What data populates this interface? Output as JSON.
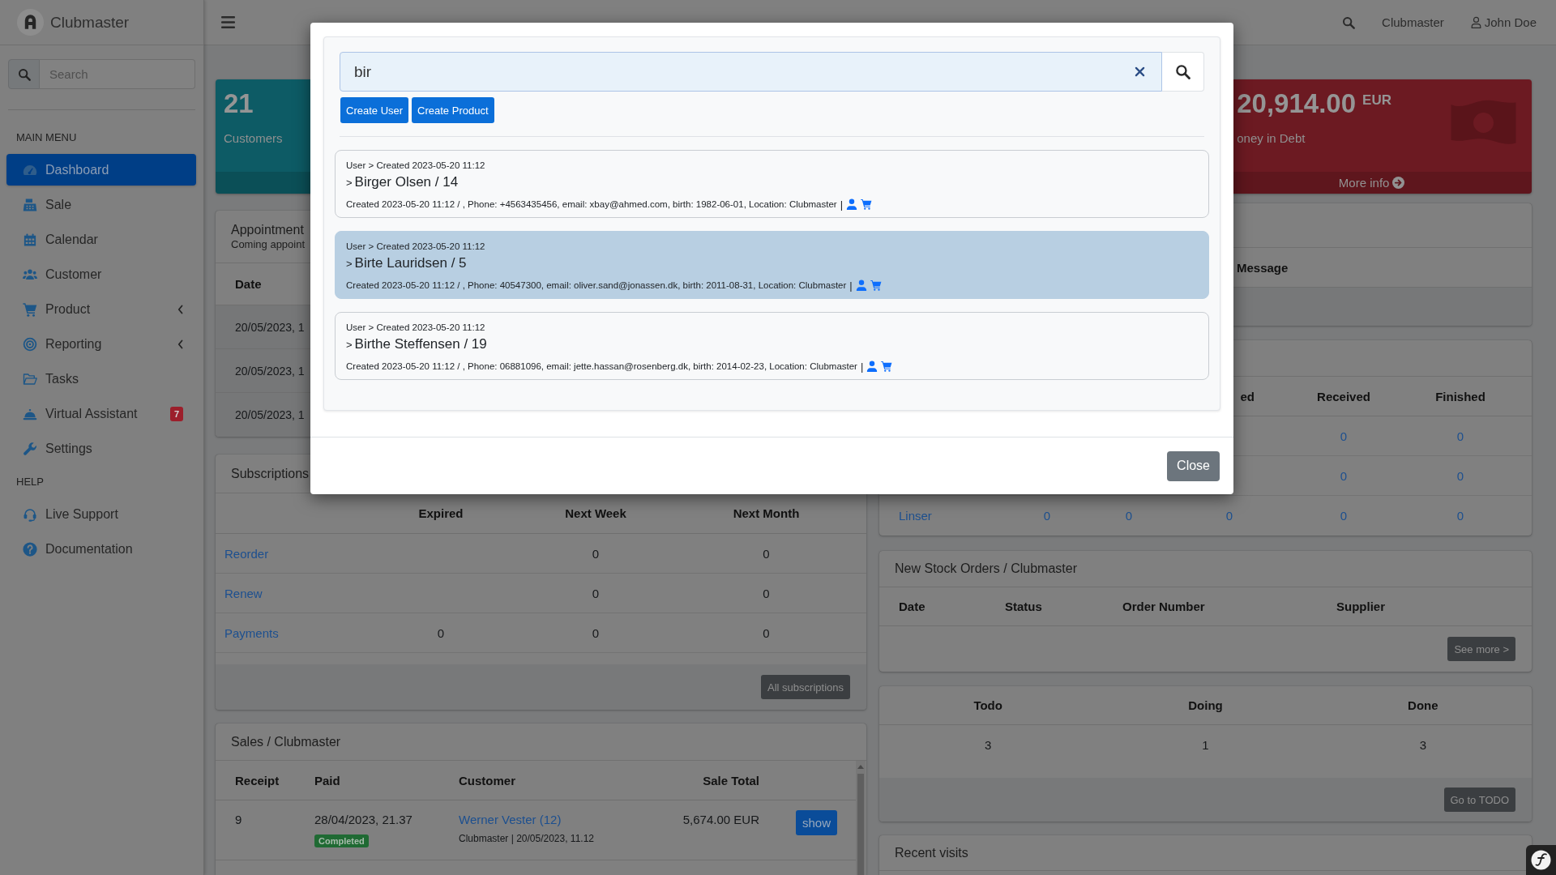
{
  "sidebar": {
    "brand": "Clubmaster",
    "search": {
      "placeholder": "Search"
    },
    "sections": [
      {
        "heading": "MAIN MENU",
        "items": [
          {
            "label": "Dashboard",
            "kind": "link",
            "selected": true
          },
          {
            "label": "Sale",
            "kind": "link",
            "selected": false
          },
          {
            "label": "Calendar",
            "kind": "link",
            "selected": false
          },
          {
            "label": "Customer",
            "kind": "link",
            "selected": false
          },
          {
            "label": "Product",
            "kind": "submenu",
            "selected": false
          },
          {
            "label": "Reporting",
            "kind": "submenu",
            "selected": false
          },
          {
            "label": "Tasks",
            "kind": "link",
            "selected": false
          },
          {
            "label": "Virtual Assistant",
            "kind": "link",
            "selected": false,
            "badge": "7"
          },
          {
            "label": "Settings",
            "kind": "link",
            "selected": false
          }
        ]
      },
      {
        "heading": "HELP",
        "items": [
          {
            "label": "Live Support",
            "kind": "link",
            "selected": false
          },
          {
            "label": "Documentation",
            "kind": "link",
            "selected": false
          }
        ]
      }
    ]
  },
  "topbar": {
    "site": "Clubmaster",
    "user": "John Doe"
  },
  "info_boxes": [
    {
      "value": "21",
      "label": "Customers",
      "color": "#0d5b65"
    },
    {
      "value": "20,914.00",
      "unit": "EUR",
      "label": "oney in Debt",
      "link": "More info",
      "color": "#6c1a22"
    }
  ],
  "appointments": {
    "title": "Appointment",
    "subtitle": "Coming appoint",
    "columns": [
      "Date"
    ],
    "rows": [
      {
        "date": "20/05/2023, 1"
      },
      {
        "date": "20/05/2023, 1"
      },
      {
        "date": "20/05/2023, 1"
      }
    ]
  },
  "subscriptions": {
    "title": "Subscriptions",
    "columns": [
      "Expired",
      "Next Week",
      "Next Month"
    ],
    "rows": [
      {
        "name": "Reorder",
        "next_week": "0",
        "next_month": "0"
      },
      {
        "name": "Renew",
        "next_week": "0",
        "next_month": "0"
      },
      {
        "name": "Payments",
        "expired": "0",
        "next_week": "0",
        "next_month": "0"
      }
    ],
    "button": "All subscriptions"
  },
  "sales": {
    "title": "Sales / Clubmaster",
    "columns": [
      "Receipt",
      "Paid",
      "Customer",
      "Sale Total"
    ],
    "rows": [
      {
        "receipt": "9",
        "paid": "28/04/2023, 21.37",
        "status": "Completed",
        "customer": "Werner Vester (12)",
        "customer_info": "Clubmaster | 20/05/2023, 11.12",
        "total": "5,674.00 EUR",
        "action": "show"
      }
    ]
  },
  "message_table": {
    "columns": [
      "Message"
    ]
  },
  "order_table": {
    "columns": {
      "column_3": "ed",
      "received": "Received",
      "finished": "Finished"
    },
    "rows": [
      {
        "received": "0",
        "finished": "0"
      },
      {
        "received": "0",
        "finished": "0"
      },
      {
        "name": "Linser",
        "column_1": "0",
        "column_2": "0",
        "column_3": "0",
        "received": "0",
        "finished": "0"
      }
    ]
  },
  "stock_orders": {
    "title": "New Stock Orders / Clubmaster",
    "columns": [
      "Date",
      "Status",
      "Order Number",
      "Supplier"
    ],
    "button": "See more >"
  },
  "tasks": {
    "columns": [
      "Todo",
      "Doing",
      "Done"
    ],
    "values": [
      "3",
      "1",
      "3"
    ],
    "button": "Go to TODO"
  },
  "recent_visits": {
    "title": "Recent visits"
  },
  "search_modal": {
    "search": {
      "value": "bir"
    },
    "buttons": [
      "Create User",
      "Create Product"
    ],
    "results": [
      {
        "meta": "User > Created 2023-05-20 11:12",
        "marker": ">",
        "name": "Birger Olsen / 14",
        "details": "Created 2023-05-20 11:12 / , Phone: +4563435456, email: xbay@ahmed.com, birth: 1982-06-01, Location: Clubmaster",
        "separator": "|",
        "selected": false
      },
      {
        "meta": "User > Created 2023-05-20 11:12",
        "marker": ">",
        "name": "Birte Lauridsen / 5",
        "details": "Created 2023-05-20 11:12 / , Phone: 40547300, email: oliver.sand@jonassen.dk, birth: 2011-08-31, Location: Clubmaster",
        "separator": "|",
        "selected": true
      },
      {
        "meta": "User > Created 2023-05-20 11:12",
        "marker": ">",
        "name": "Birthe Steffensen / 19",
        "details": "Created 2023-05-20 11:12 / , Phone: 06881096, email: jette.hassan@rosenberg.dk, birth: 2014-02-23, Location: Clubmaster",
        "separator": "|",
        "selected": false
      }
    ],
    "close": "Close"
  }
}
